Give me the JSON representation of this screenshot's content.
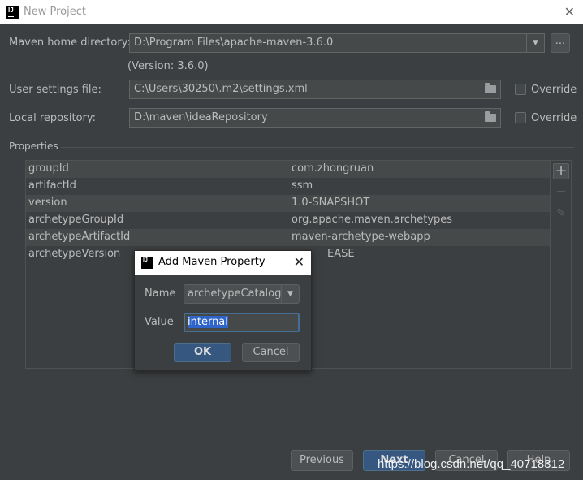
{
  "window": {
    "title": "New Project",
    "close": "✕"
  },
  "maven": {
    "home_label": "Maven home directory:",
    "home_value": "D:\\Program Files\\apache-maven-3.6.0",
    "browse_label": "...",
    "version_text": "(Version: 3.6.0)",
    "settings_label": "User settings file:",
    "settings_value": "C:\\Users\\30250\\.m2\\settings.xml",
    "settings_override": "Override",
    "repo_label": "Local repository:",
    "repo_value": "D:\\maven\\ideaRepository",
    "repo_override": "Override"
  },
  "properties": {
    "section_label": "Properties",
    "rows": [
      {
        "key": "groupId",
        "value": "com.zhongruan"
      },
      {
        "key": "artifactId",
        "value": "ssm"
      },
      {
        "key": "version",
        "value": "1.0-SNAPSHOT"
      },
      {
        "key": "archetypeGroupId",
        "value": "org.apache.maven.archetypes"
      },
      {
        "key": "archetypeArtifactId",
        "value": "maven-archetype-webapp"
      },
      {
        "key": "archetypeVersion",
        "value": "EASE"
      }
    ],
    "tools": {
      "add": "+",
      "remove": "−",
      "edit": "✎"
    }
  },
  "dialog": {
    "title": "Add Maven Property",
    "close": "✕",
    "name_label": "Name",
    "name_value": "archetypeCatalog",
    "value_label": "Value",
    "value_text": "internal",
    "ok_label": "OK",
    "cancel_label": "Cancel"
  },
  "footer": {
    "previous_label": "Previous",
    "next_label": "Next",
    "cancel_label": "Cancel",
    "help_label": "Help"
  },
  "watermark": "https://blog.csdn.net/qq_40718312",
  "colors": {
    "background": "#3c3f41",
    "primary_button": "#365880",
    "selection": "#2f65ca"
  }
}
